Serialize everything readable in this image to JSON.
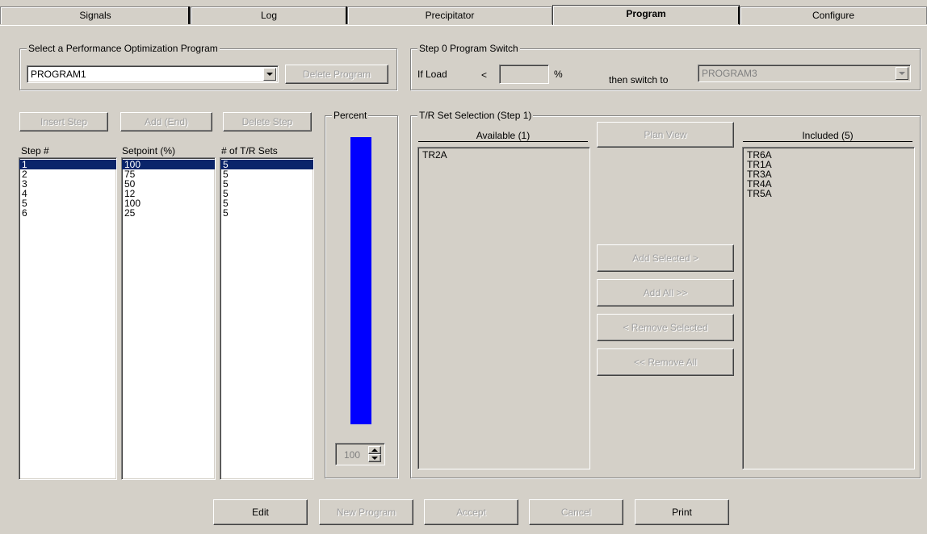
{
  "tabs": [
    {
      "label": "Signals",
      "active": false
    },
    {
      "label": "Log",
      "active": false
    },
    {
      "label": "Precipitator",
      "active": false
    },
    {
      "label": "Program",
      "active": true
    },
    {
      "label": "Configure",
      "active": false
    }
  ],
  "program_select": {
    "legend": "Select a Performance Optimization Program",
    "selected": "PROGRAM1",
    "delete_label": "Delete Program"
  },
  "step0": {
    "legend": "Step 0 Program Switch",
    "if_load_label": "If Load",
    "less_than": "<",
    "load_value": "",
    "percent_sign": "%",
    "then_label": "then switch to",
    "switch_program": "PROGRAM3"
  },
  "steps": {
    "insert_label": "Insert Step",
    "add_end_label": "Add (End)",
    "delete_label": "Delete Step",
    "col_step": "Step #",
    "col_setpoint": "Setpoint (%)",
    "col_trsets": "# of T/R Sets",
    "rows": [
      {
        "step": "1",
        "setpoint": "100",
        "trsets": "5"
      },
      {
        "step": "2",
        "setpoint": "75",
        "trsets": "5"
      },
      {
        "step": "3",
        "setpoint": "50",
        "trsets": "5"
      },
      {
        "step": "4",
        "setpoint": "12",
        "trsets": "5"
      },
      {
        "step": "5",
        "setpoint": "100",
        "trsets": "5"
      },
      {
        "step": "6",
        "setpoint": "25",
        "trsets": "5"
      }
    ],
    "selected_index": 0
  },
  "percent": {
    "legend": "Percent",
    "value": "100",
    "level": 1.0,
    "bar_color": "#0000ff"
  },
  "trset": {
    "legend": "T/R Set Selection (Step 1)",
    "available_header": "Available (1)",
    "available": [
      "TR2A"
    ],
    "included_header": "Included (5)",
    "included": [
      "TR6A",
      "TR1A",
      "TR3A",
      "TR4A",
      "TR5A"
    ],
    "plan_view_label": "Plan View",
    "add_selected_label": "Add Selected >",
    "add_all_label": "Add All >>",
    "remove_selected_label": "< Remove Selected",
    "remove_all_label": "<< Remove All"
  },
  "footer": {
    "edit_label": "Edit",
    "new_program_label": "New Program",
    "accept_label": "Accept",
    "cancel_label": "Cancel",
    "print_label": "Print"
  },
  "colors": {
    "face": "#d4d0c8",
    "selection": "#0a246a"
  }
}
